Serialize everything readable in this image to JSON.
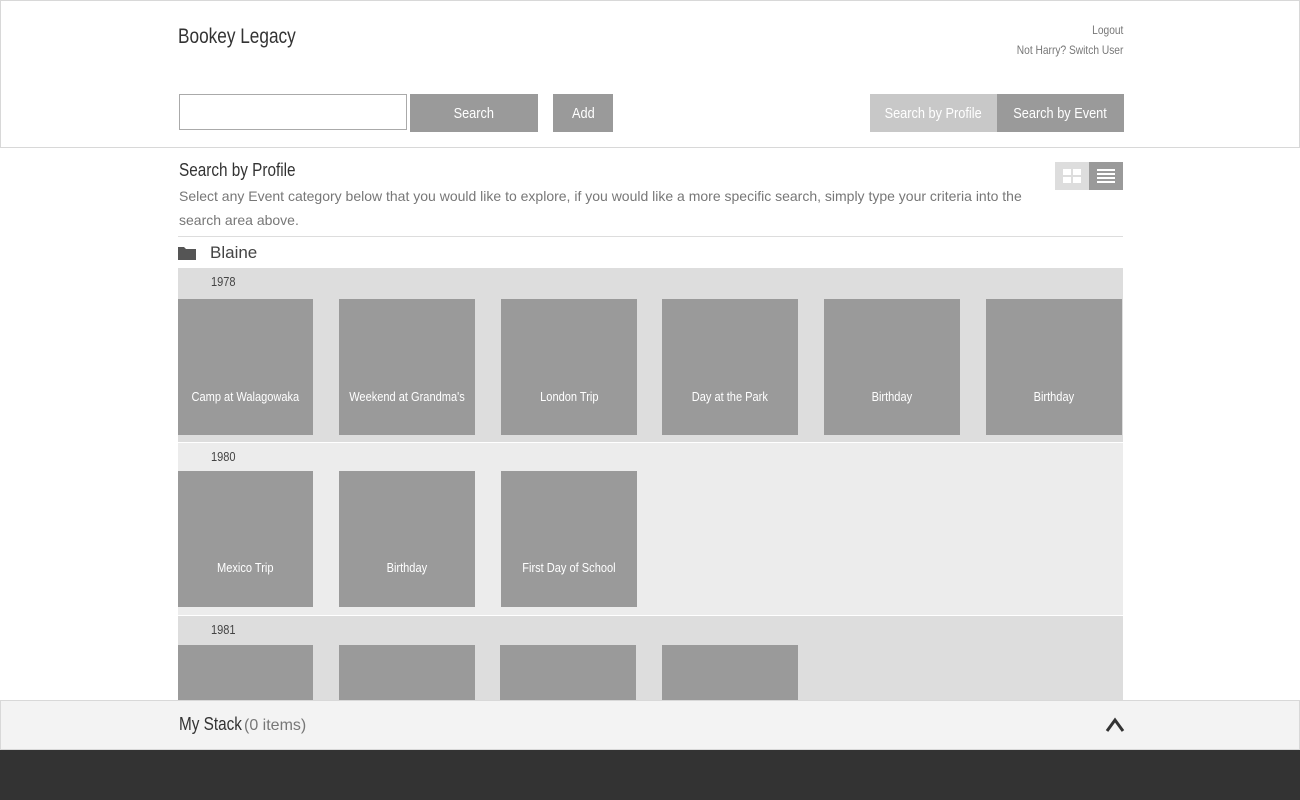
{
  "header": {
    "brand": "Bookey Legacy",
    "logout": "Logout",
    "switch_user": "Not Harry? Switch User"
  },
  "search": {
    "placeholder": "",
    "search_label": "Search",
    "add_label": "Add",
    "by_profile_label": "Search by Profile",
    "by_event_label": "Search by Event"
  },
  "main": {
    "title": "Search by Profile",
    "description": "Select any Event category below that you would like to explore, if you would like a more specific search, simply type your criteria into the search area above.",
    "profile": "Blaine",
    "groups": [
      {
        "year": "1978",
        "events": [
          "Camp at Walagowaka",
          "Weekend at Grandma's",
          "London Trip",
          "Day at the Park",
          "Birthday",
          "Birthday"
        ]
      },
      {
        "year": "1980",
        "events": [
          "Mexico Trip",
          "Birthday",
          "First Day of School"
        ]
      },
      {
        "year": "1981",
        "events": [
          "",
          "",
          "",
          ""
        ]
      }
    ]
  },
  "stack": {
    "title": "My Stack",
    "count": "(0 items)"
  },
  "colors": {
    "tile": "#9a9a9a",
    "active_button": "#9a9a9a",
    "inactive_button": "#c8c8c8",
    "footer": "#333333"
  },
  "icons": [
    "grid-view-icon",
    "list-view-icon",
    "folder-icon",
    "chevron-up-icon"
  ]
}
